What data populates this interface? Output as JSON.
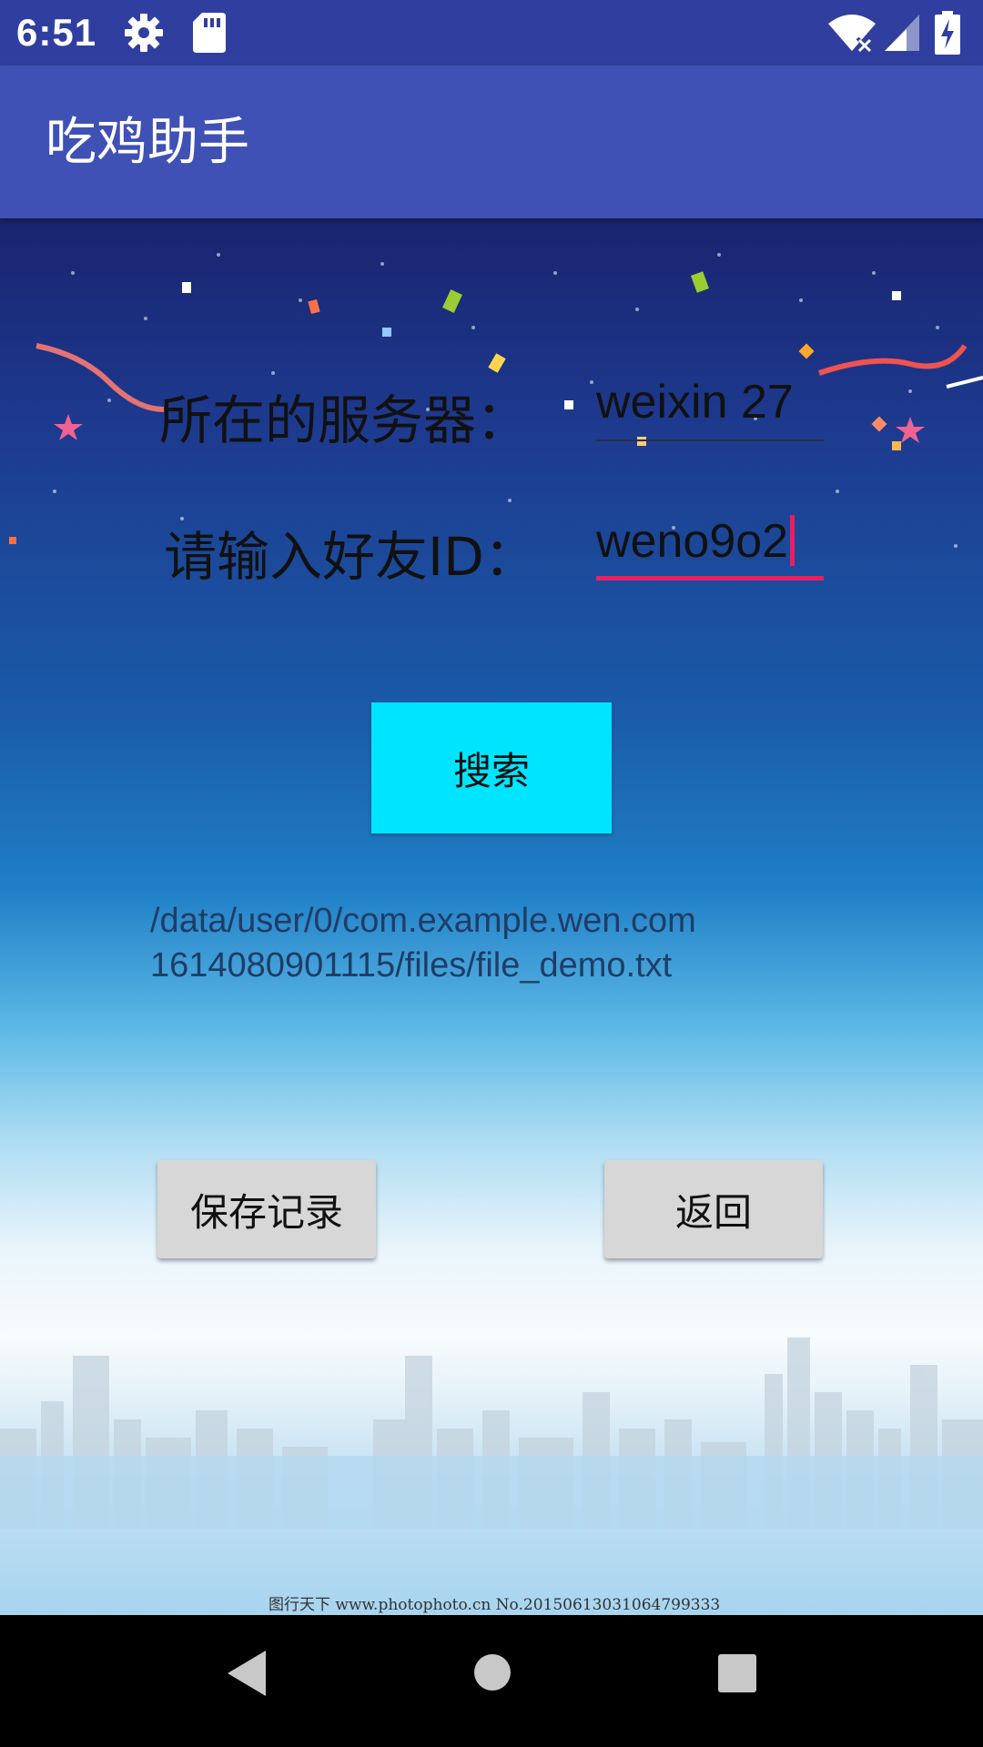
{
  "status_bar": {
    "time": "6:51",
    "icons": [
      "gear-icon",
      "sd-card-icon",
      "wifi-off-icon",
      "signal-icon",
      "battery-charging-icon"
    ],
    "color": "#303f9f"
  },
  "app_bar": {
    "title": "吃鸡助手",
    "color": "#3f51b5"
  },
  "form": {
    "server_label": "所在的服务器：",
    "server_value": "weixin 27",
    "friend_id_label": "请输入好友ID：",
    "friend_id_value": "weno9o2",
    "accent_color": "#e91e63"
  },
  "search_button": {
    "label": "搜索",
    "color": "#00e5ff"
  },
  "file_path": "/data/user/0/com.example.wen.com1614080901115/files/file_demo.txt",
  "actions": {
    "save_label": "保存记录",
    "back_label": "返回"
  },
  "watermark": "图行天下 www.photophoto.cn No.20150613031064799333",
  "nav_bar": {
    "icons": [
      "back-icon",
      "home-icon",
      "recents-icon"
    ]
  }
}
